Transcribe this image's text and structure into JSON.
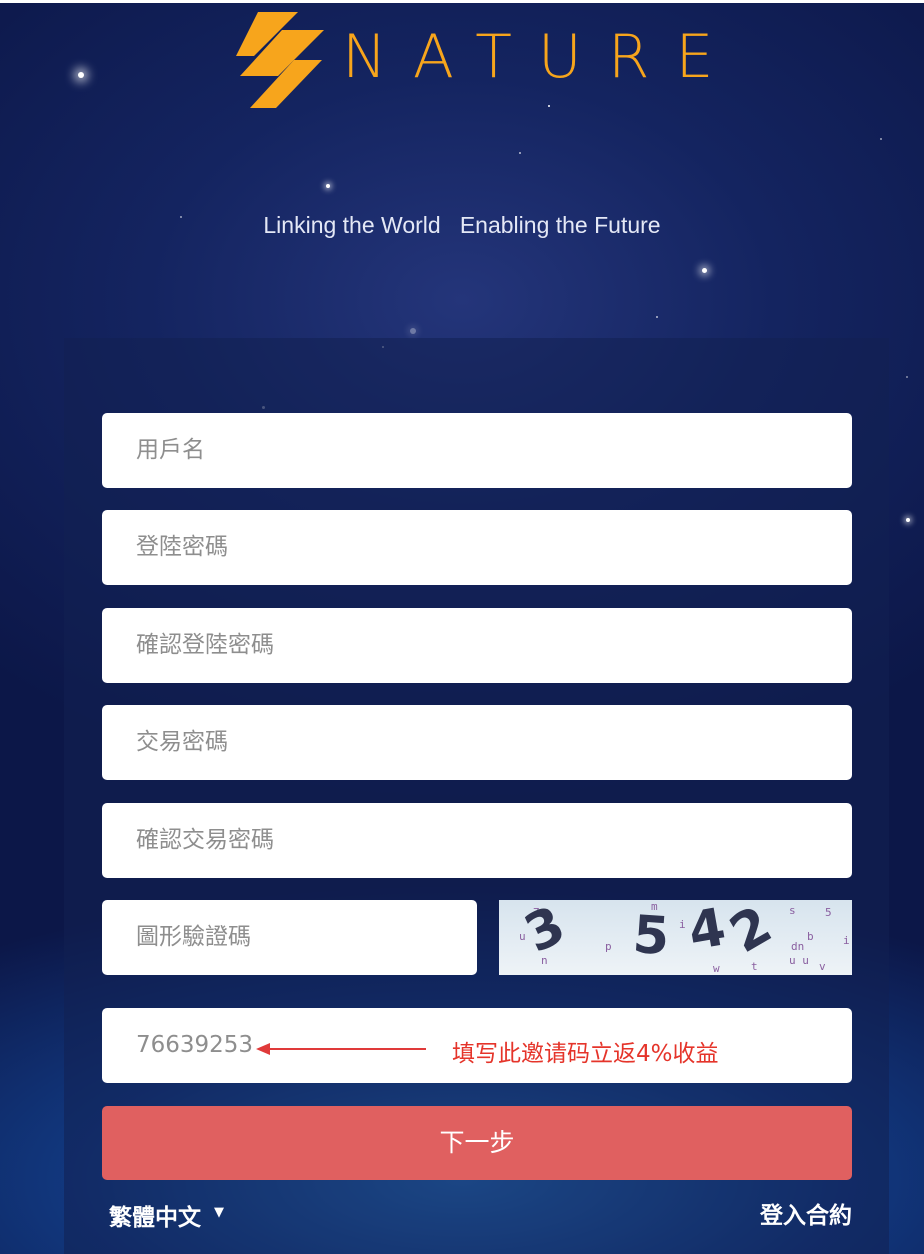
{
  "brand": {
    "name": "NATURE",
    "slogan": "Linking the World   Enabling the Future"
  },
  "form": {
    "username_placeholder": "用戶名",
    "login_password_placeholder": "登陸密碼",
    "confirm_login_password_placeholder": "確認登陸密碼",
    "trade_password_placeholder": "交易密碼",
    "confirm_trade_password_placeholder": "確認交易密碼",
    "captcha_placeholder": "圖形驗證碼",
    "captcha_image_text": "3542",
    "invite_code_value": "76639253"
  },
  "annotation": {
    "text": "填写此邀请码立返4%收益",
    "color": "#e5342a"
  },
  "actions": {
    "next_label": "下一步",
    "next_color": "#e06060"
  },
  "footer": {
    "language_label": "繁體中文",
    "language_caret": "▼",
    "agreement_label": "登入合約"
  },
  "colors": {
    "accent": "#f7a51c"
  }
}
